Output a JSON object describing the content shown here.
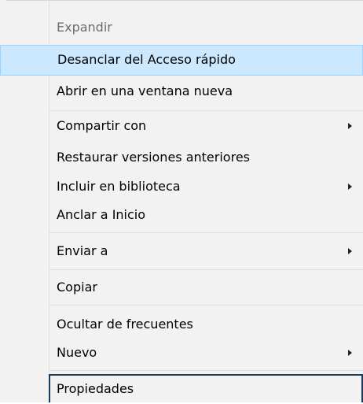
{
  "context_menu": {
    "items": [
      {
        "label": "Expandir"
      },
      {
        "label": "Desanclar del Acceso rápido"
      },
      {
        "label": "Abrir en una ventana nueva"
      },
      {
        "label": "Compartir con"
      },
      {
        "label": "Restaurar versiones anteriores"
      },
      {
        "label": "Incluir en biblioteca"
      },
      {
        "label": "Anclar a Inicio"
      },
      {
        "label": "Enviar a"
      },
      {
        "label": "Copiar"
      },
      {
        "label": "Ocultar de frecuentes"
      },
      {
        "label": "Nuevo"
      },
      {
        "label": "Propiedades"
      }
    ],
    "highlight_color": "#cce8ff",
    "focus_border_color": "#1b3a5a"
  }
}
